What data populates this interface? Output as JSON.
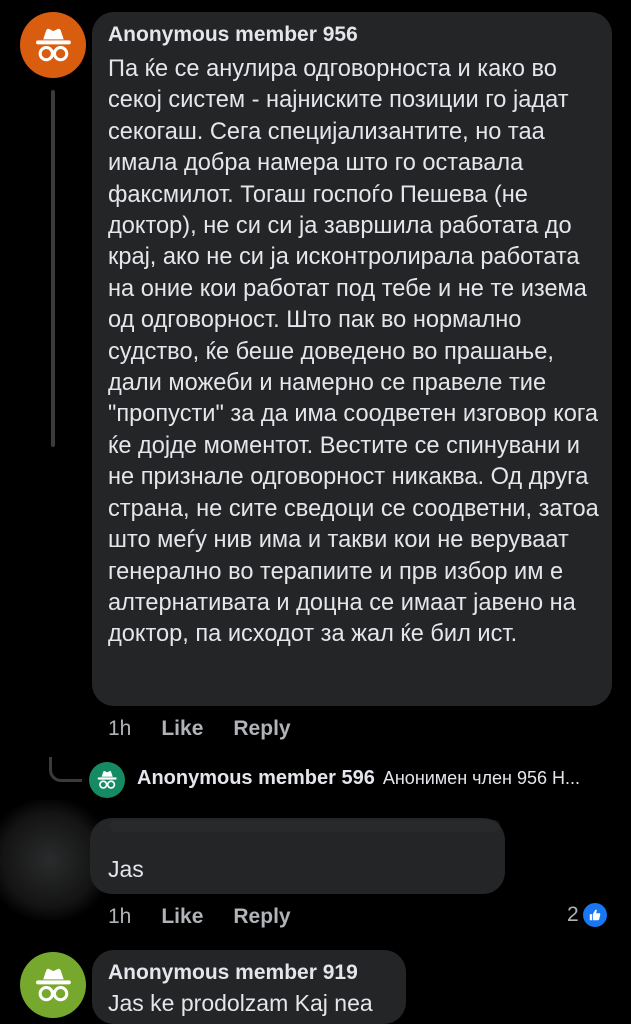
{
  "comment": {
    "author": "Anonymous member 956",
    "text": "Па ќе се анулира одговорноста и како во секој систем - најниските позиции го јадат секогаш. Сега специјализантите, но таа имала добра намера што го оставала факсмилот. Тогаш госпоѓо Пешева (не доктор), не си си ја завршила работата до крај, ако не си ја исконтролирала работата на оние кои работат под тебе и не те изема од одговорност. Што пак во нормално судство, ќе беше доведено во прашање, дали можеби и намерно се правеле тие \"пропусти\" за да има соодветен изговор кога ќе дојде моментот. Вестите се спинувани и не признале одговорност никаква. Од друга страна, не сите сведоци се соодветни, затоа што меѓу нив има и такви кои не веруваат генерално во терапиите и прв избор им е алтернативата и доцна се имаат јавено на доктор, па исходот за жал ќе бил ист.",
    "time": "1h",
    "like_label": "Like",
    "reply_label": "Reply"
  },
  "reply_preview": {
    "author": "Anonymous member 596",
    "snippet": "Анонимен член 956 Н..."
  },
  "reply": {
    "text": "Jas",
    "time": "1h",
    "like_label": "Like",
    "reply_label": "Reply",
    "reaction_count": "2"
  },
  "next_comment": {
    "author": "Anonymous member 919",
    "text": "Jas ke prodolzam Kaj nea"
  },
  "icons": {
    "avatar": "anonymous-spy-icon",
    "reaction": "thumbs-up-icon"
  },
  "colors": {
    "background": "#000000",
    "bubble": "#242526",
    "avatar_main": "#d95d0f",
    "avatar_reply": "#168a63",
    "avatar_next": "#76a82e",
    "like_badge": "#1877f2"
  }
}
